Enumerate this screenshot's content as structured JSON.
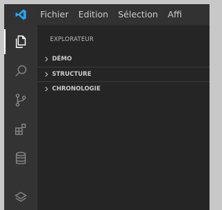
{
  "menu": [
    "Fichier",
    "Edition",
    "Sélection",
    "Affi"
  ],
  "activity_bar": [
    "files-icon",
    "search-icon",
    "source-control-icon",
    "extensions-icon",
    "database-icon",
    "layers-icon"
  ],
  "explorer": {
    "title": "EXPLORATEUR",
    "sections": [
      "DÉMO",
      "STRUCTURE",
      "CHRONOLOGIE"
    ]
  },
  "colors": {
    "accent": "#23a8f2",
    "titlebar": "#323233",
    "activitybar": "#333333",
    "sidebar": "#252526"
  }
}
